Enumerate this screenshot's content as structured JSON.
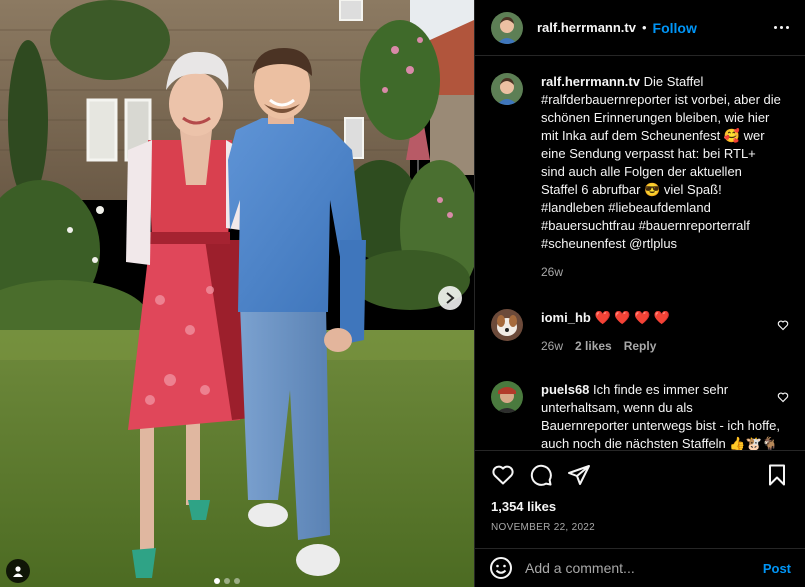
{
  "post": {
    "author": "ralf.herrmann.tv",
    "separator": "•",
    "follow_label": "Follow",
    "caption_author": "ralf.herrmann.tv",
    "caption_text": " Die Staffel #ralfderbauernreporter ist vorbei, aber die schönen Erinnerungen bleiben, wie hier mit Inka auf dem Scheunenfest 🥰 wer eine Sendung verpasst hat: bei RTL+ sind auch alle Folgen der aktuellen Staffel 6 abrufbar 😎 viel Spaß! #landleben #liebeaufdemland #bauersuchtfrau #bauernreporterralf #scheunenfest @rtlplus",
    "caption_age": "26w",
    "likes": "1,354 likes",
    "date": "NOVEMBER 22, 2022"
  },
  "comments": [
    {
      "user": "iomi_hb",
      "text": " ❤️ ❤️ ❤️ ❤️",
      "age": "26w",
      "likes": "2 likes",
      "reply": "Reply"
    },
    {
      "user": "puels68",
      "text": " Ich finde es immer sehr unterhaltsam, wenn du als Bauernreporter unterwegs bist - ich hoffe, auch noch die nächsten Staffeln 👍🐮🐐🐑🐄 freue mich"
    }
  ],
  "add_comment": {
    "placeholder": "Add a comment...",
    "post_label": "Post"
  },
  "carousel": {
    "slide_count": 3,
    "active_index": 0
  },
  "icons": {
    "more": "more-options-icon",
    "like": "heart-icon",
    "comment": "comment-icon",
    "share": "send-icon",
    "save": "bookmark-icon",
    "emoji": "emoji-icon",
    "next": "chevron-right-icon",
    "tags": "user-tag-icon"
  },
  "colors": {
    "accent": "#0095f6",
    "background": "#000000",
    "heart_red": "#ed4956"
  }
}
